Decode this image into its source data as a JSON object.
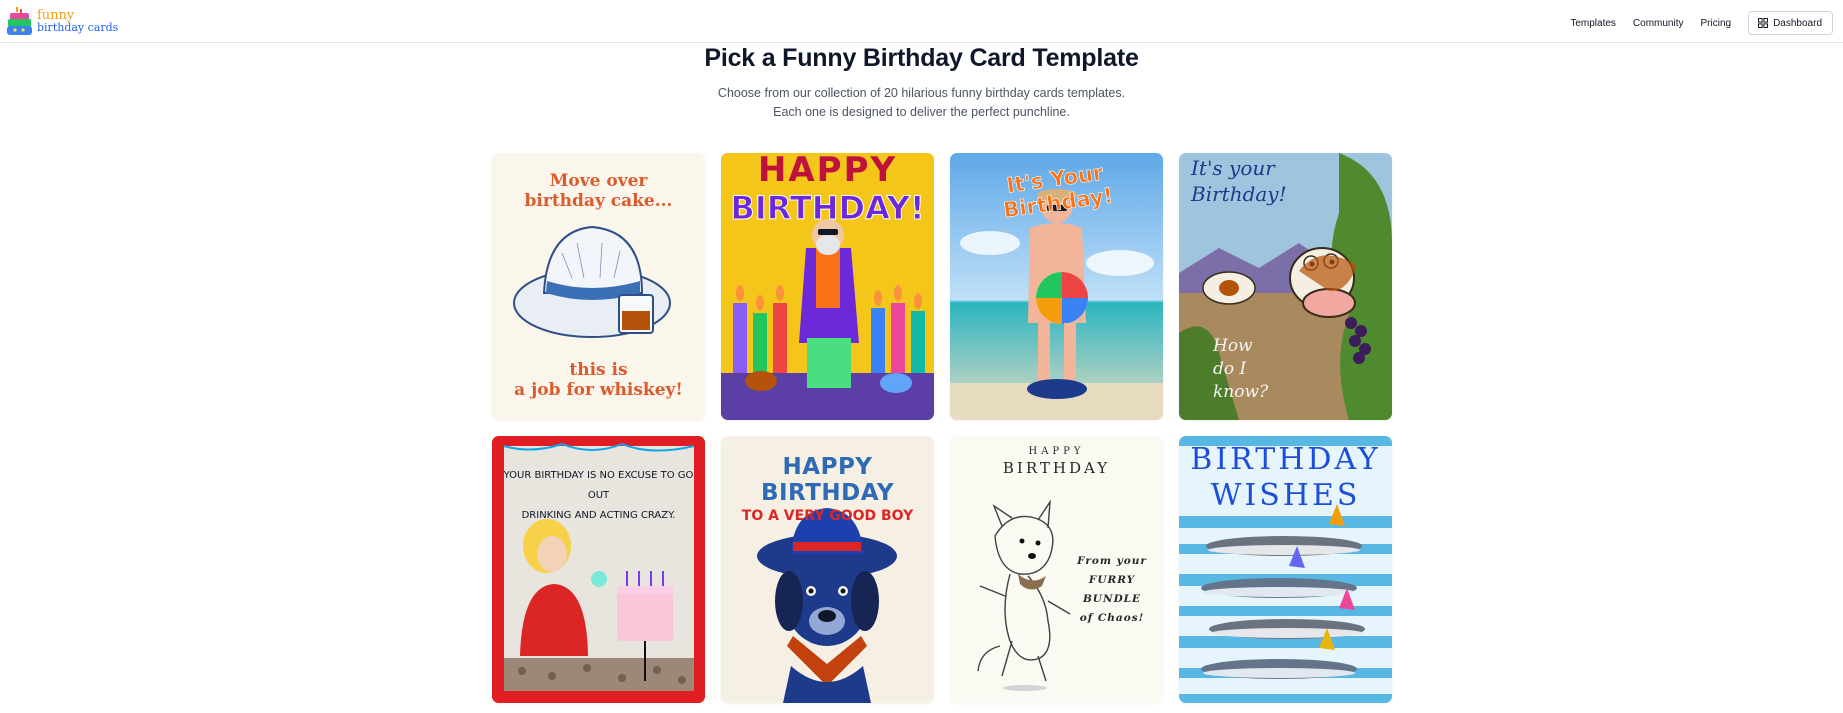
{
  "header": {
    "logo_line1": "funny",
    "logo_line2": "birthday cards",
    "nav": [
      "Templates",
      "Community",
      "Pricing"
    ],
    "dashboard_label": "Dashboard",
    "dashboard_icon": "grid-icon"
  },
  "hero": {
    "title": "Pick a Funny Birthday Card Template",
    "subtitle_line1": "Choose from our collection of 20 hilarious funny birthday cards templates.",
    "subtitle_line2": "Each one is designed to deliver the perfect punchline."
  },
  "cards": [
    {
      "top": "Move over birthday cake...",
      "top_l1": "Move over",
      "top_l2": "birthday cake...",
      "bottom_l1": "this is",
      "bottom_l2": "a job for whiskey!"
    },
    {
      "l1": "HAPPY",
      "l2": "BIRTHDAY!"
    },
    {
      "title": "It's Your Birthday!"
    },
    {
      "l1": "It's your",
      "l2": "Birthday!",
      "b1": "How",
      "b2": "do I",
      "b3": "know?"
    },
    {
      "l1": "YOUR BIRTHDAY IS NO EXCUSE TO GO OUT",
      "l2": "DRINKING AND ACTING CRAZY."
    },
    {
      "l1": "HAPPY BIRTHDAY",
      "l2": "TO A VERY GOOD BOY"
    },
    {
      "l1": "HAPPY",
      "l2": "BIRTHDAY",
      "f1": "From your",
      "f2": "FURRY",
      "f3": "BUNDLE",
      "f4": "of Chaos!"
    },
    {
      "l1": "BIRTHDAY",
      "l2": "WISHES"
    }
  ],
  "colors": {
    "accent": "#111827",
    "muted": "#4b5563",
    "border": "#e5e7eb"
  }
}
